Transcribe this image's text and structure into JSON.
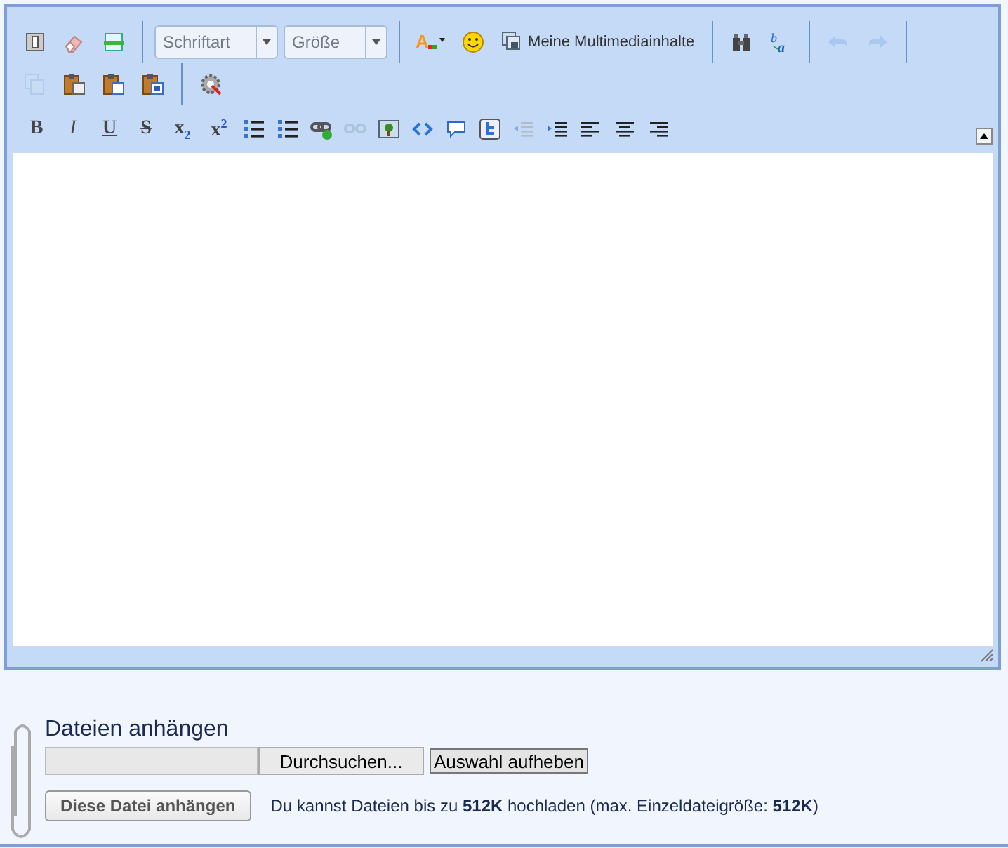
{
  "toolbar": {
    "main_row": [
      {
        "kind": "source",
        "disabled": false
      },
      {
        "kind": "eraser",
        "disabled": false
      },
      {
        "kind": "template",
        "disabled": false
      },
      {
        "kind": "separator"
      },
      {
        "kind": "select",
        "placeholder": "Schriftart"
      },
      {
        "kind": "select",
        "placeholder": "Größe"
      },
      {
        "kind": "separator"
      },
      {
        "kind": "textcolor",
        "text": "A",
        "disabled": false
      },
      {
        "kind": "smiley",
        "disabled": false
      },
      {
        "kind": "media",
        "label": "Meine Multimediainhalte",
        "disabled": false
      },
      {
        "kind": "separator"
      },
      {
        "kind": "find",
        "disabled": false
      },
      {
        "kind": "spell",
        "text": "b",
        "text_2": "a",
        "disabled": false
      },
      {
        "kind": "separator"
      },
      {
        "kind": "undo",
        "disabled": true
      },
      {
        "kind": "redo",
        "disabled": true
      },
      {
        "kind": "separator"
      }
    ],
    "clipboard_row": [
      {
        "kind": "copy",
        "disabled": true
      },
      {
        "kind": "paste",
        "disabled": false
      },
      {
        "kind": "pastetext",
        "disabled": false
      },
      {
        "kind": "pasteword",
        "disabled": false
      },
      {
        "kind": "separator"
      },
      {
        "kind": "settings",
        "disabled": false
      }
    ],
    "format_row": [
      {
        "kind": "bold",
        "text": "B",
        "disabled": false
      },
      {
        "kind": "italic",
        "text": "I",
        "disabled": false
      },
      {
        "kind": "underline",
        "text": "U",
        "disabled": false
      },
      {
        "kind": "strike",
        "text": "S",
        "disabled": false
      },
      {
        "kind": "subscript",
        "text": "x$_{2}$",
        "disabled": false
      },
      {
        "kind": "superscript",
        "text": "x$^{2}$",
        "disabled": false
      },
      {
        "kind": "bullets",
        "disabled": false
      },
      {
        "kind": "numbers",
        "disabled": false
      },
      {
        "kind": "link",
        "disabled": false
      },
      {
        "kind": "unlink",
        "disabled": true
      },
      {
        "kind": "image",
        "disabled": false
      },
      {
        "kind": "code",
        "disabled": false
      },
      {
        "kind": "comment",
        "disabled": false
      },
      {
        "kind": "tweet",
        "disabled": false
      },
      {
        "kind": "outdent",
        "disabled": true
      },
      {
        "kind": "indent",
        "disabled": false
      },
      {
        "kind": "alignleft",
        "disabled": false
      },
      {
        "kind": "aligncenter",
        "disabled": false
      },
      {
        "kind": "alignright",
        "disabled": false
      }
    ],
    "collapsed": false
  },
  "attachments": {
    "title": "Dateien anhängen",
    "browse_button": "Durchsuchen...",
    "clear_button": "Auswahl aufheben",
    "attach_button": "Diese Datei anhängen",
    "info": "Du kannst Dateien bis zu **512K** hochladen (max. Einzeldateigröße: **512K**)"
  }
}
